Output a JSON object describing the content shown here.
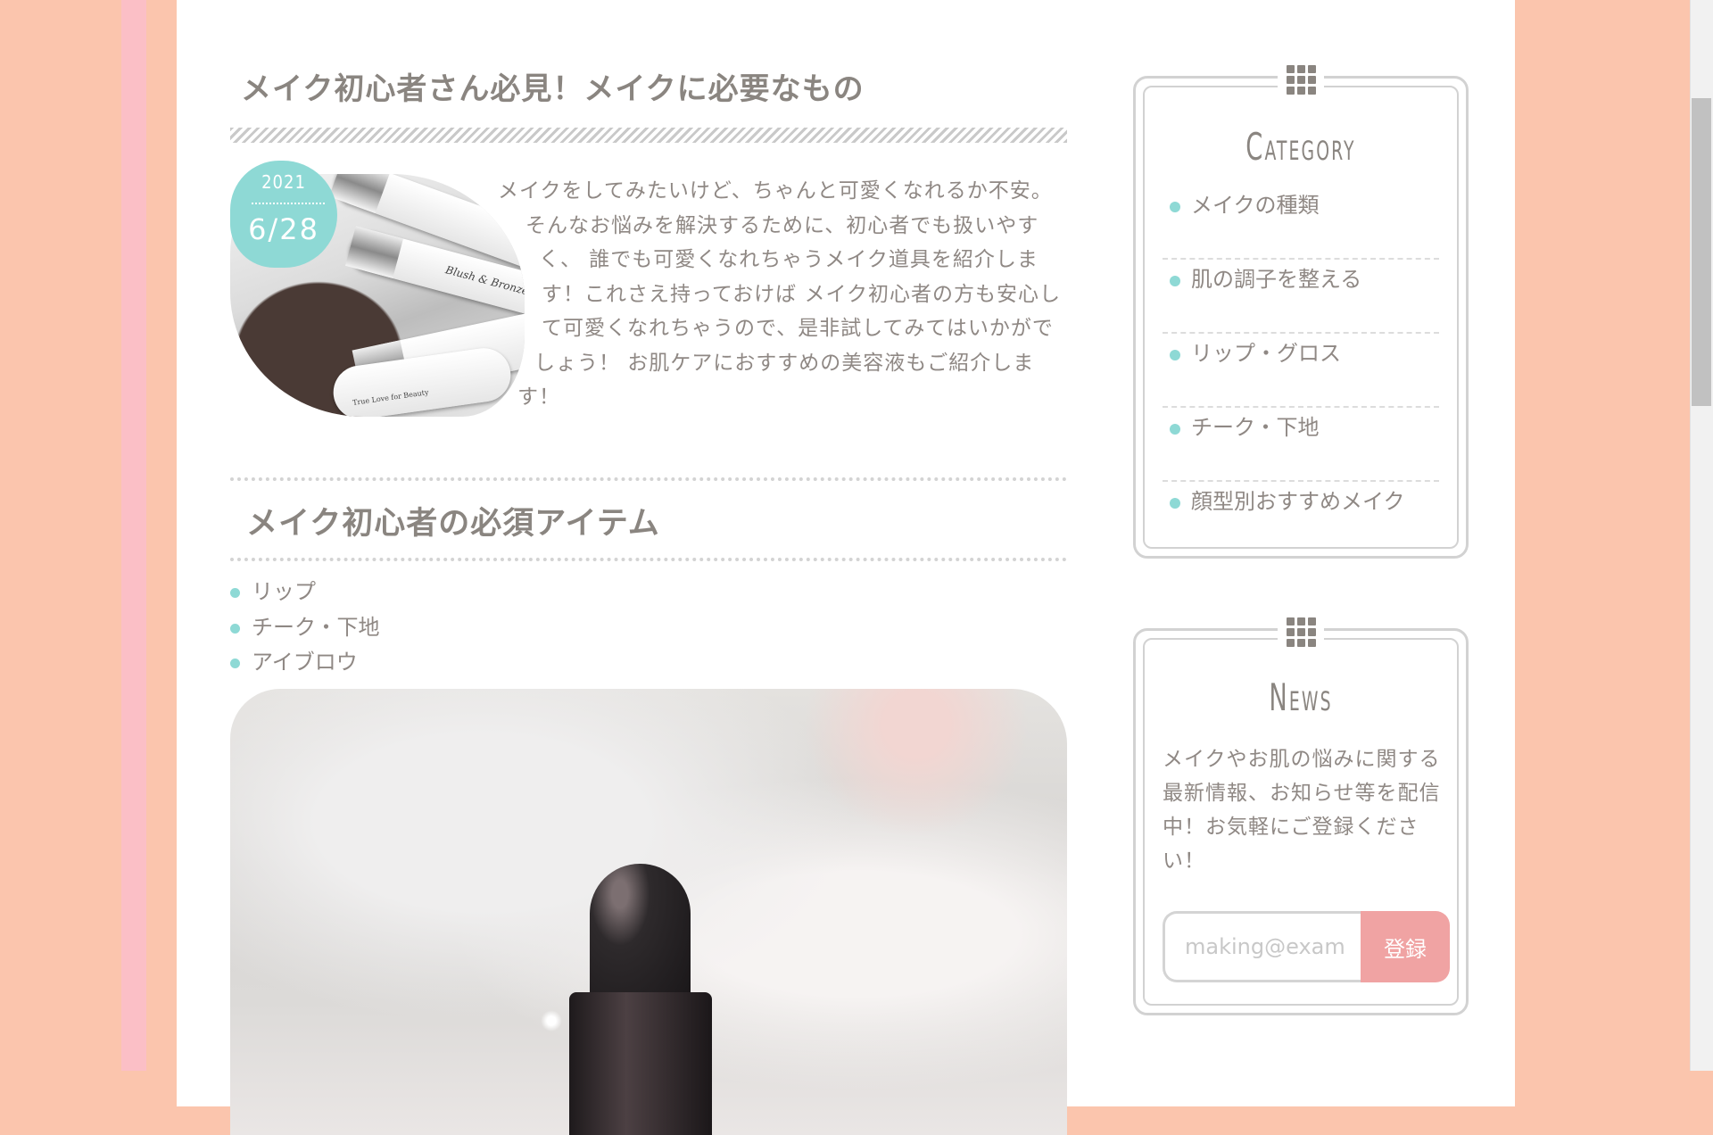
{
  "article": {
    "title": "メイク初心者さん必見！メイクに必要なもの",
    "date": {
      "year": "2021",
      "month_day": "6/28"
    },
    "thumbnail_labels": [
      "Blush & Bronze",
      "True Love for Beauty"
    ],
    "intro_lines": [
      "メイクをしてみたいけど、ちゃんと可愛くなれるか不安。",
      "そんなお悩みを解決するために、初心者でも扱いやす",
      "く、 誰でも可愛くなれちゃうメイク道具を紹介しま",
      "す！これさえ持っておけば メイク初心者の方も安心し",
      "て可愛くなれちゃうので、是非試してみてはいかがで",
      "しょう！ お肌ケアにおすすめの美容液もご紹介しま",
      "す！"
    ],
    "section_heading": "メイク初心者の必須アイテム",
    "items": [
      "リップ",
      "チーク・下地",
      "アイブロウ"
    ]
  },
  "sidebar": {
    "category": {
      "title": "Category",
      "items": [
        "メイクの種類",
        "肌の調子を整える",
        "リップ・グロス",
        "チーク・下地",
        "顔型別おすすめメイク"
      ]
    },
    "news": {
      "title": "News",
      "lines": [
        "メイクやお肌の悩みに関する",
        "最新情報、お知らせ等を配信",
        "中！お気軽にご登録くださ",
        "い！"
      ],
      "email_placeholder": "making@example.com",
      "submit_label": "登録"
    }
  },
  "colors": {
    "background": "#fbc5ad",
    "pink_band": "#fbbfc6",
    "accent_teal": "#8ed9d5",
    "button_pink": "#f0a3a3",
    "text": "#8e8680"
  },
  "icons": [
    "grid-icon"
  ]
}
